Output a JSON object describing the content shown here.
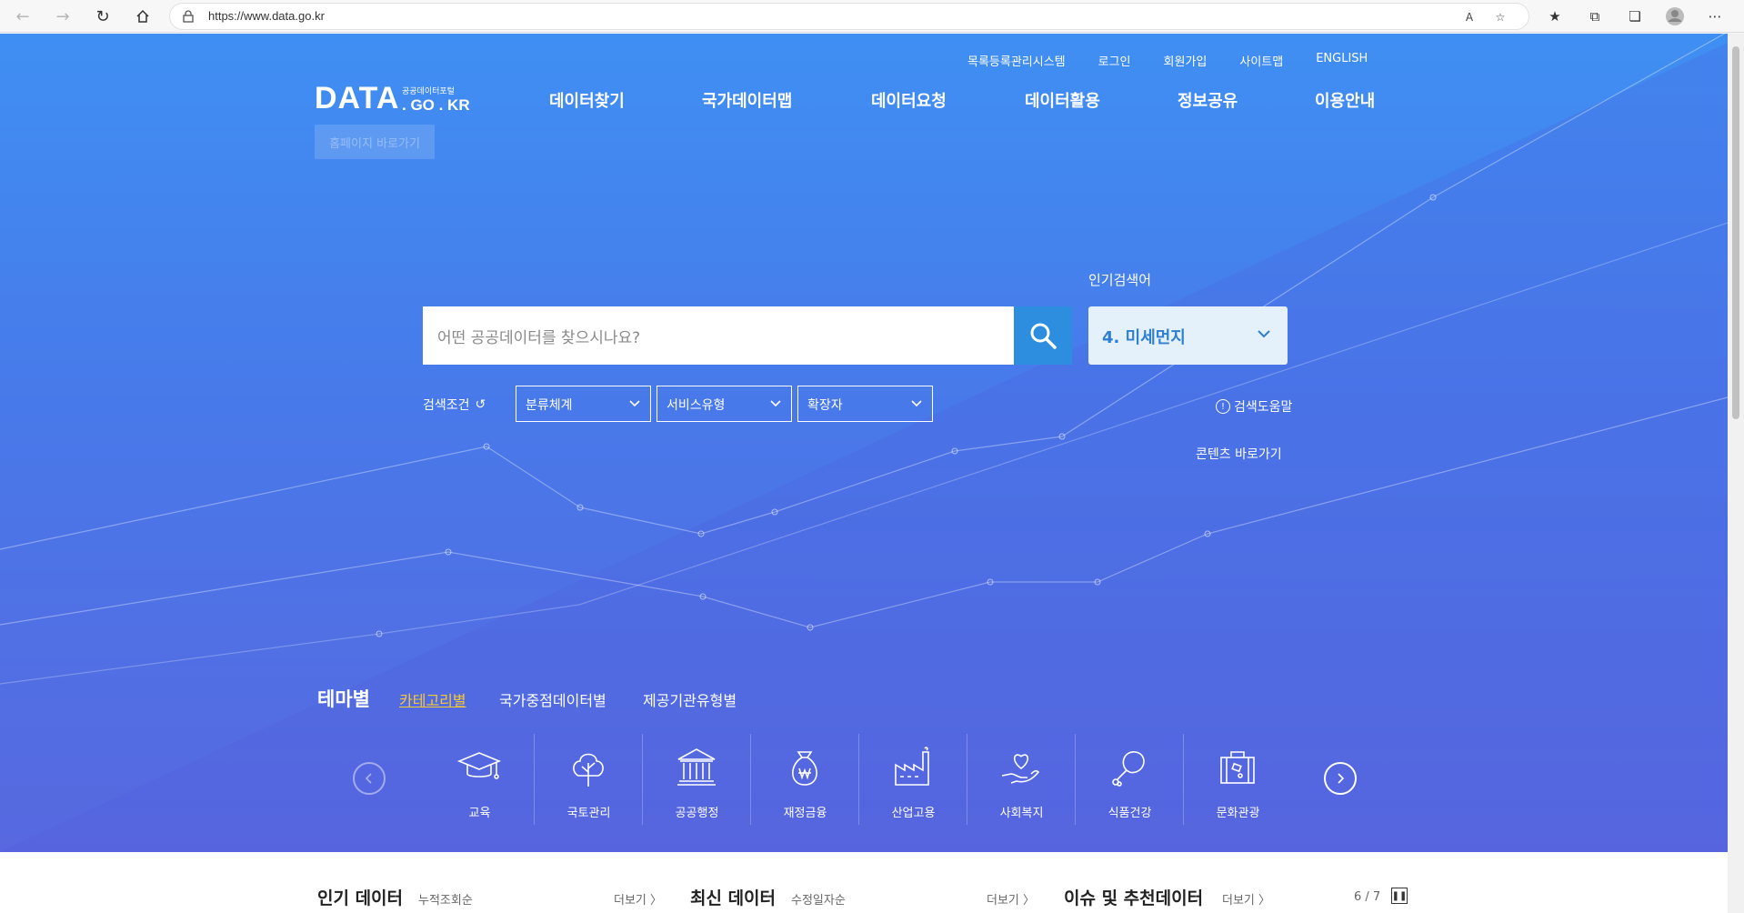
{
  "browser": {
    "url_host": "https://www.data.go.kr",
    "read_aloud_label": "A"
  },
  "util_nav": [
    "목록등록관리시스템",
    "로그인",
    "회원가입",
    "사이트맵",
    "ENGLISH"
  ],
  "logo": {
    "main": "DATA",
    "subtitle": "공공데이터포털",
    "domain": ". GO . KR"
  },
  "skip_link": "홈페이지 바로가기",
  "gnb": [
    "데이터찾기",
    "국가데이터맵",
    "데이터요청",
    "데이터활용",
    "정보공유",
    "이용안내"
  ],
  "search": {
    "placeholder": "어떤 공공데이터를 찾으시나요?",
    "popular_label": "인기검색어",
    "popular_value": "4. 미세먼지",
    "conditions_label": "검색조건",
    "selects": [
      "분류체계",
      "서비스유형",
      "확장자"
    ],
    "help": "검색도움말",
    "contents_link": "콘텐츠 바로가기"
  },
  "theme_tabs": {
    "main": "테마별",
    "active": "카테고리별",
    "others": [
      "국가중점데이터별",
      "제공기관유형별"
    ]
  },
  "categories": [
    {
      "label": "교육",
      "icon": "graduation-cap-icon"
    },
    {
      "label": "국토관리",
      "icon": "tree-icon"
    },
    {
      "label": "공공행정",
      "icon": "government-building-icon"
    },
    {
      "label": "재정금융",
      "icon": "money-bag-icon"
    },
    {
      "label": "산업고용",
      "icon": "factory-icon"
    },
    {
      "label": "사회복지",
      "icon": "heart-hand-icon"
    },
    {
      "label": "식품건강",
      "icon": "drumstick-icon"
    },
    {
      "label": "문화관광",
      "icon": "suitcase-icon"
    }
  ],
  "bottom": {
    "popular_title": "인기 데이터",
    "popular_sub": "누적조회순",
    "popular_more": "더보기 〉",
    "latest_title": "최신 데이터",
    "latest_sub": "수정일자순",
    "latest_more": "더보기 〉",
    "issue_title": "이슈 및 추천데이터",
    "issue_more": "더보기 〉",
    "pager": "6 / 7"
  },
  "colors": {
    "hero_top": "#3f8ff3",
    "hero_bottom": "#5868df",
    "search_button": "#2d8ee0",
    "active_tab": "#f5c934"
  }
}
